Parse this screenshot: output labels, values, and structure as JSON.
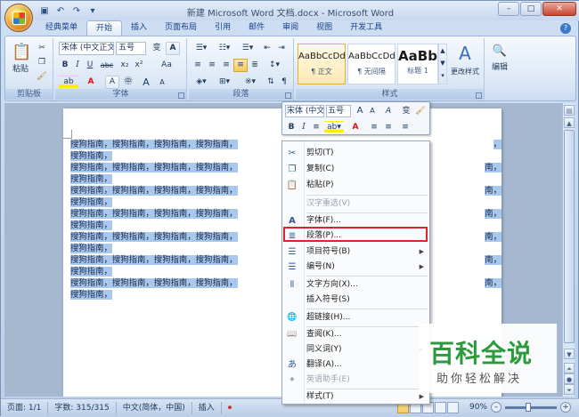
{
  "app": {
    "title": "新建 Microsoft Word 文档.docx - Microsoft Word",
    "window_controls": [
      "–",
      "□",
      "✕"
    ],
    "help": "?"
  },
  "tabs": [
    {
      "label": "经典菜单"
    },
    {
      "label": "开始",
      "active": true
    },
    {
      "label": "插入"
    },
    {
      "label": "页面布局"
    },
    {
      "label": "引用"
    },
    {
      "label": "邮件"
    },
    {
      "label": "审阅"
    },
    {
      "label": "视图"
    },
    {
      "label": "开发工具"
    }
  ],
  "ribbon": {
    "clipboard": {
      "label": "剪贴板",
      "paste": "粘贴"
    },
    "font": {
      "label": "字体",
      "family": "宋体 (中文正文)",
      "size": "五号",
      "big_a": "A"
    },
    "paragraph": {
      "label": "段落"
    },
    "styles": {
      "label": "样式",
      "items": [
        {
          "sample": "AaBbCcDd",
          "name": "¶ 正文"
        },
        {
          "sample": "AaBbCcDd",
          "name": "¶ 无间隔"
        },
        {
          "sample": "AaBb",
          "name": "标题 1"
        }
      ],
      "change_styles": "更改样式"
    },
    "editing": {
      "label": "编辑"
    }
  },
  "document": {
    "line_text": "搜狗指南，搜狗指南，搜狗指南，搜狗指南，",
    "right_text": "搜狗指南，搜狗指南，搜狗指南，",
    "short_line": "搜狗指南，",
    "paragraph_count": 7
  },
  "mini_toolbar": {
    "font": "宋体 (中文",
    "size": "五号",
    "buttons": [
      "A",
      "A",
      "A",
      "变",
      "B",
      "I",
      "≡",
      "A",
      "≡",
      "≡",
      "≡"
    ]
  },
  "context_menu": {
    "items": [
      {
        "label": "剪切(T)",
        "icon": "scissors-icon",
        "glyph": "✂"
      },
      {
        "label": "复制(C)",
        "icon": "copy-icon",
        "glyph": "❐"
      },
      {
        "label": "粘贴(P)",
        "icon": "paste-icon",
        "glyph": "📋"
      },
      {
        "label": "汉字重选(V)",
        "disabled": true
      },
      {
        "label": "字体(F)...",
        "icon": "font-icon",
        "glyph": "A"
      },
      {
        "label": "段落(P)...",
        "icon": "paragraph-icon",
        "glyph": "≣",
        "highlighted": true
      },
      {
        "label": "项目符号(B)",
        "icon": "bullets-icon",
        "glyph": "☰",
        "submenu": true
      },
      {
        "label": "编号(N)",
        "icon": "numbering-icon",
        "glyph": "☰",
        "submenu": true
      },
      {
        "label": "文字方向(X)...",
        "icon": "text-direction-icon",
        "glyph": "⫴"
      },
      {
        "label": "插入符号(S)"
      },
      {
        "label": "超链接(H)...",
        "icon": "hyperlink-icon",
        "glyph": "🌐"
      },
      {
        "label": "查阅(K)...",
        "icon": "lookup-icon",
        "glyph": "📖"
      },
      {
        "label": "同义词(Y)",
        "submenu": true
      },
      {
        "label": "翻译(A)...",
        "icon": "translate-icon",
        "glyph": "あ"
      },
      {
        "label": "英语助手(E)",
        "icon": "english-assistant-icon",
        "glyph": "✦",
        "disabled": true
      },
      {
        "label": "样式(T)",
        "submenu": true
      }
    ]
  },
  "status_bar": {
    "page": "页面: 1/1",
    "words": "字数: 315/315",
    "language": "中文(简体，中国)",
    "mode": "插入",
    "zoom": "90%",
    "zoom_level": 0.9
  },
  "watermark": {
    "title": "百科全说",
    "subtitle": "助你轻松解决"
  }
}
